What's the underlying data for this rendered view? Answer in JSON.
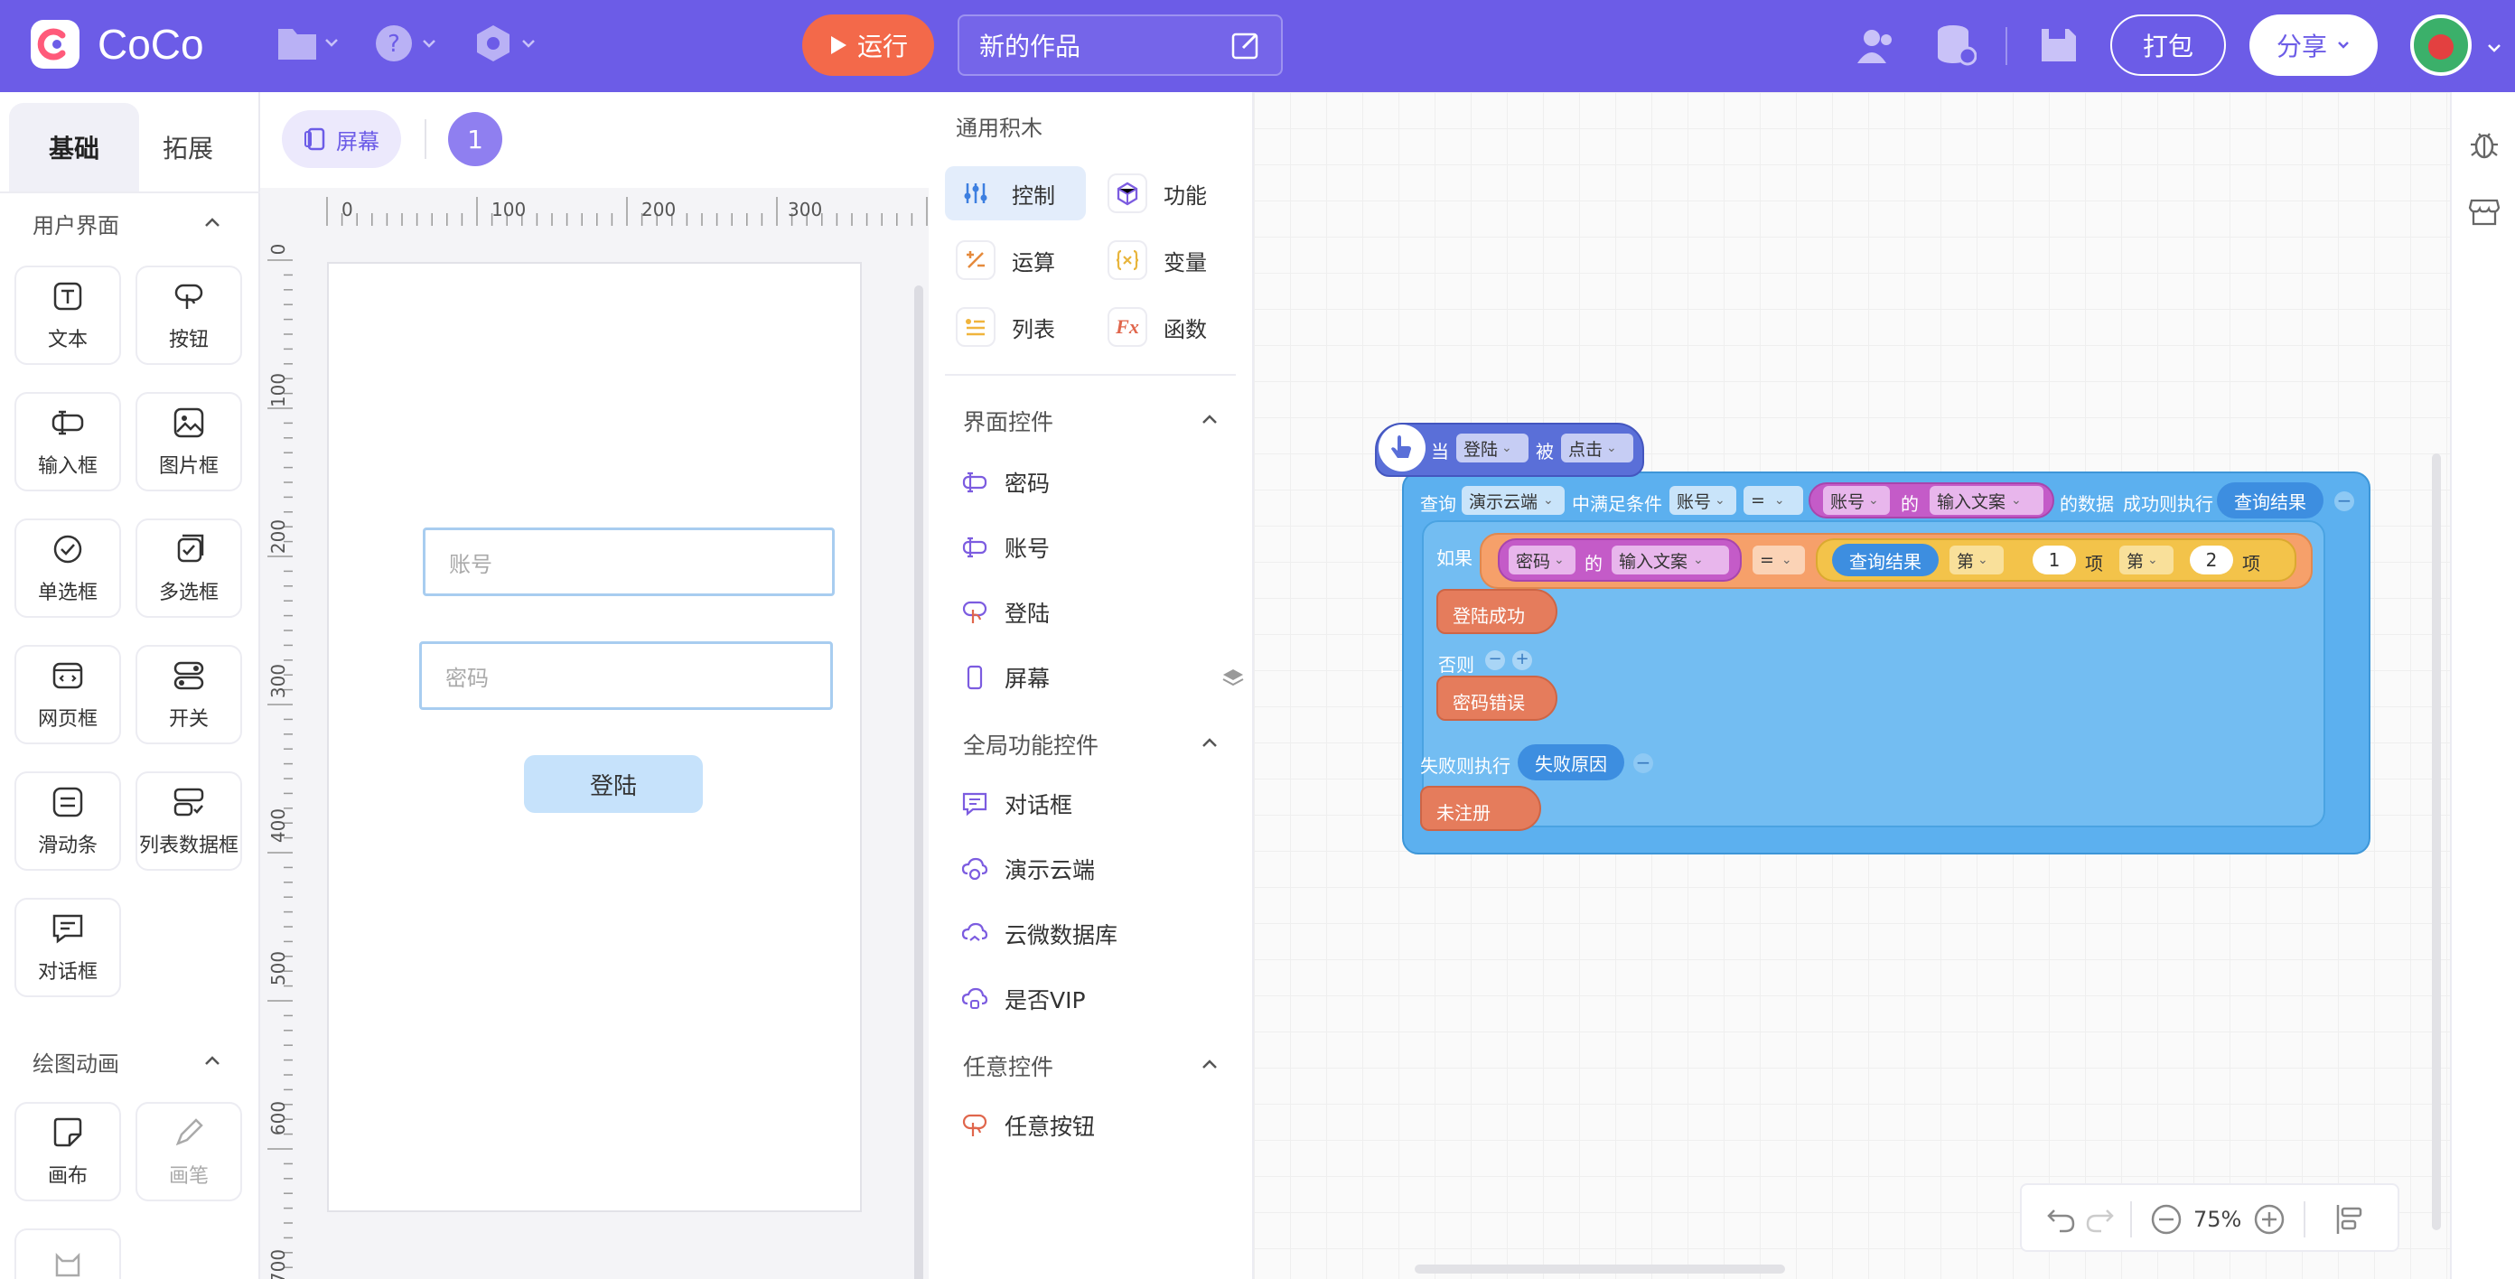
{
  "app": {
    "name": "CoCo",
    "project_title": "新的作品"
  },
  "toolbar": {
    "run_label": "运行",
    "pack_label": "打包",
    "share_label": "分享"
  },
  "left_panel": {
    "tabs": [
      "基础",
      "拓展"
    ],
    "sections": [
      {
        "title": "用户界面",
        "items": [
          "文本",
          "按钮",
          "输入框",
          "图片框",
          "单选框",
          "多选框",
          "网页框",
          "开关",
          "滑动条",
          "列表数据框",
          "对话框"
        ]
      },
      {
        "title": "绘图动画",
        "items": [
          "画布",
          "画笔"
        ]
      }
    ]
  },
  "screen_area": {
    "screen_tab": "屏幕",
    "screen_number": "1",
    "ruler_x": [
      "0",
      "100",
      "200",
      "300"
    ],
    "ruler_y": [
      "0",
      "100",
      "200",
      "300",
      "400",
      "500",
      "600",
      "700"
    ],
    "phone": {
      "account_placeholder": "账号",
      "password_placeholder": "密码",
      "login_button": "登陆"
    }
  },
  "palette": {
    "section_title": "通用积木",
    "categories": [
      {
        "label": "控制",
        "icon": "control-icon",
        "color": "#3d7fe0"
      },
      {
        "label": "功能",
        "icon": "function-icon",
        "color": "#7c5ce0"
      },
      {
        "label": "运算",
        "icon": "operator-icon",
        "color": "#e58a3c"
      },
      {
        "label": "变量",
        "icon": "variable-icon",
        "color": "#e8b53c"
      },
      {
        "label": "列表",
        "icon": "list-icon",
        "color": "#f0b43c"
      },
      {
        "label": "函数",
        "icon": "fx-icon",
        "color": "#e0664c"
      }
    ],
    "ui_controls_title": "界面控件",
    "ui_controls": [
      "密码",
      "账号",
      "登陆",
      "屏幕"
    ],
    "global_controls_title": "全局功能控件",
    "global_controls": [
      "对话框",
      "演示云端",
      "云微数据库",
      "是否VIP"
    ],
    "any_controls_title": "任意控件",
    "any_controls": [
      "任意按钮"
    ]
  },
  "blocks": {
    "event": {
      "when": "当",
      "target": "登陆",
      "by": "被",
      "action": "点击"
    },
    "query": {
      "query": "查询",
      "source": "演示云端",
      "cond": "中满足条件",
      "field": "账号",
      "op": "=",
      "obj": "账号",
      "of": "的",
      "prop": "输入文案",
      "data": "的数据",
      "success": "成功则执行",
      "result": "查询结果"
    },
    "if": {
      "if": "如果",
      "obj": "密码",
      "of": "的",
      "prop": "输入文案",
      "op": "=",
      "result": "查询结果",
      "nth1": "第",
      "idx1": "1",
      "item1": "项",
      "nth2": "第",
      "idx2": "2",
      "item2": "项"
    },
    "then_action": "登陆成功",
    "else": "否则",
    "else_action": "密码错误",
    "fail": {
      "label": "失败则执行",
      "reason": "失败原因"
    },
    "fail_action": "未注册"
  },
  "zoom": {
    "level": "75%"
  }
}
